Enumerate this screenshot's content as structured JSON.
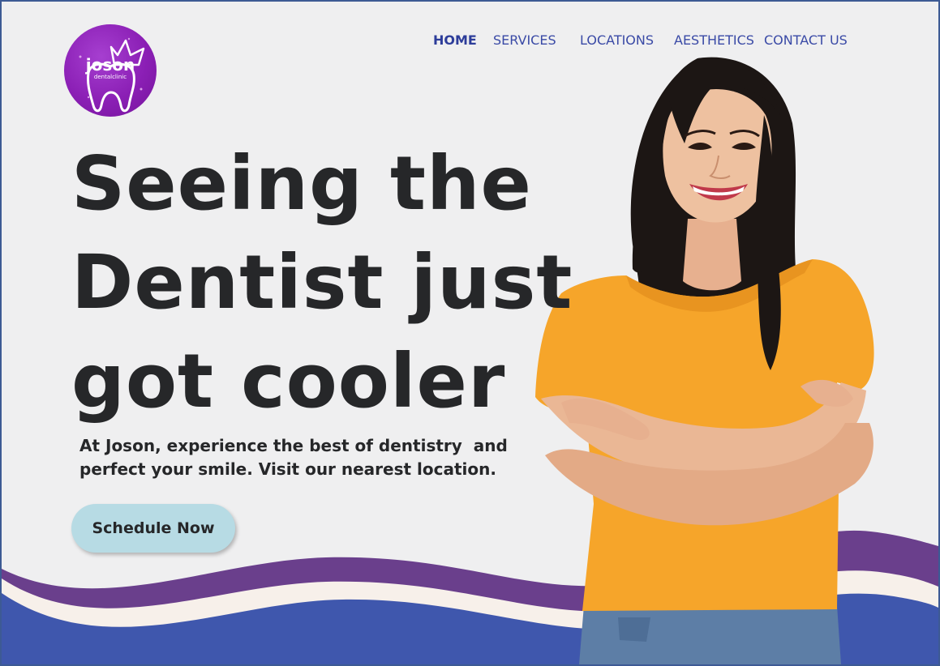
{
  "brand": {
    "name": "joson",
    "tagline": "dentalclinic"
  },
  "nav": {
    "items": [
      {
        "label": "HOME",
        "active": true
      },
      {
        "label": "SERVICES",
        "active": false
      },
      {
        "label": "LOCATIONS",
        "active": false
      },
      {
        "label": "AESTHETICS",
        "active": false
      },
      {
        "label": "CONTACT US",
        "active": false
      }
    ]
  },
  "hero": {
    "headline_lines": [
      "Seeing the",
      "Dentist just",
      "got cooler"
    ],
    "subtext_lines": [
      "At Joson, experience the best of dentistry  and",
      "perfect your smile. Visit our nearest location."
    ],
    "cta_label": "Schedule Now"
  },
  "colors": {
    "brand_purple": "#8b1fb5",
    "nav_text": "#3a4aa6",
    "headline": "#262729",
    "cta_bg": "#b7dbe4",
    "wave_purple": "#6a3f8c",
    "wave_blue": "#3f57ad",
    "wave_cream": "#f7f0ea",
    "shirt": "#f6a52a"
  }
}
